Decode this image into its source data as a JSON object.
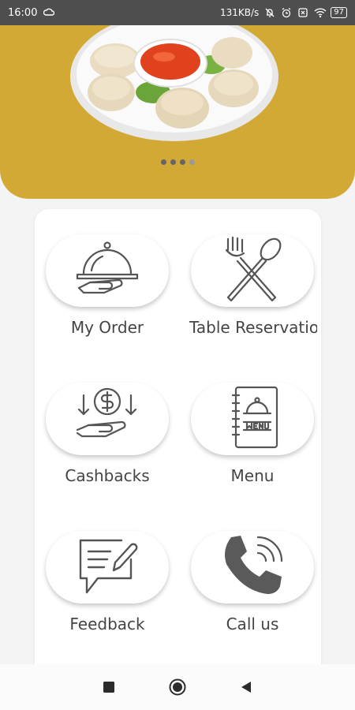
{
  "status_bar": {
    "time": "16:00",
    "network_speed": "131KB/s",
    "battery": "97"
  },
  "banner": {
    "image": "momos-plate",
    "slide_count": 4,
    "active_slide": 4
  },
  "menu_tiles": [
    {
      "label": "My Order",
      "icon": "serving-cloche-icon"
    },
    {
      "label": "Table Reservatio",
      "icon": "fork-spoon-icon"
    },
    {
      "label": "Cashbacks",
      "icon": "cashback-hand-icon"
    },
    {
      "label": "Menu",
      "icon": "menu-book-icon"
    },
    {
      "label": "Feedback",
      "icon": "feedback-message-icon"
    },
    {
      "label": "Call us",
      "icon": "phone-icon"
    }
  ],
  "colors": {
    "brand": "#d3a936",
    "status_bar": "#4e4e4e",
    "icon_stroke": "#555555",
    "text": "#444444"
  },
  "nav": {
    "back_icon": "back-triangle-icon",
    "home_icon": "home-circle-icon",
    "recents_icon": "recents-square-icon"
  }
}
